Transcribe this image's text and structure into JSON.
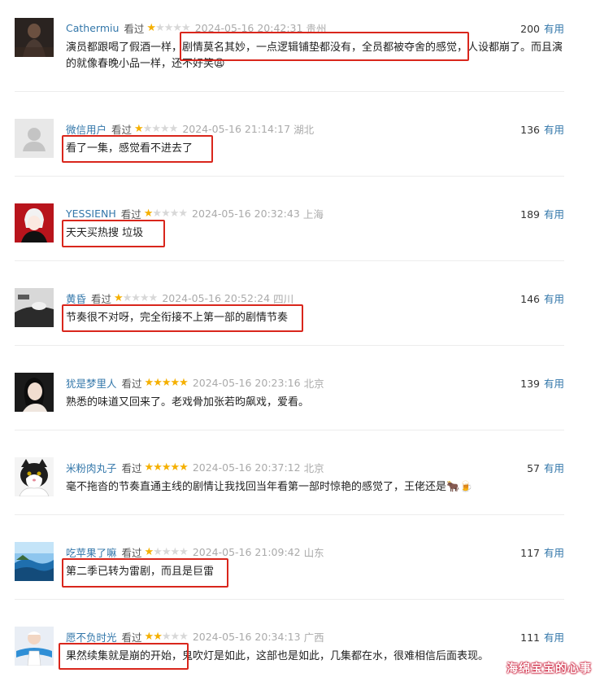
{
  "reviews": [
    {
      "user": "Cathermiu",
      "watched": "看过",
      "rating": 1,
      "time": "2024-05-16 20:42:31",
      "location": "贵州",
      "useful_count": "200",
      "useful_label": "有用",
      "content": "演员都跟喝了假酒一样，剧情莫名其妙，一点逻辑铺垫都没有，全员都被夺舍的感觉，人设都崩了。而且演的就像春晚小品一样，还不好笑😩"
    },
    {
      "user": "微信用户",
      "watched": "看过",
      "rating": 1,
      "time": "2024-05-16 21:14:17",
      "location": "湖北",
      "useful_count": "136",
      "useful_label": "有用",
      "content": "看了一集，感觉看不进去了"
    },
    {
      "user": "YESSIENH",
      "watched": "看过",
      "rating": 1,
      "time": "2024-05-16 20:32:43",
      "location": "上海",
      "useful_count": "189",
      "useful_label": "有用",
      "content": "天天买热搜 垃圾"
    },
    {
      "user": "黄昏",
      "watched": "看过",
      "rating": 1,
      "time": "2024-05-16 20:52:24",
      "location": "四川",
      "useful_count": "146",
      "useful_label": "有用",
      "content": "节奏很不对呀，完全衔接不上第一部的剧情节奏"
    },
    {
      "user": "犹是梦里人",
      "watched": "看过",
      "rating": 5,
      "time": "2024-05-16 20:23:16",
      "location": "北京",
      "useful_count": "139",
      "useful_label": "有用",
      "content": "熟悉的味道又回来了。老戏骨加张若昀飙戏，爱看。"
    },
    {
      "user": "米粉肉丸子",
      "watched": "看过",
      "rating": 5,
      "time": "2024-05-16 20:37:12",
      "location": "北京",
      "useful_count": "57",
      "useful_label": "有用",
      "content": "毫不拖沓的节奏直通主线的剧情让我找回当年看第一部时惊艳的感觉了，王佬还是🐂🍺"
    },
    {
      "user": "吃苹果了嘛",
      "watched": "看过",
      "rating": 1,
      "time": "2024-05-16 21:09:42",
      "location": "山东",
      "useful_count": "117",
      "useful_label": "有用",
      "content": "第二季已转为雷剧，而且是巨雷"
    },
    {
      "user": "愿不负时光",
      "watched": "看过",
      "rating": 2,
      "time": "2024-05-16 20:34:13",
      "location": "广西",
      "useful_count": "111",
      "useful_label": "有用",
      "content": "果然续集就是崩的开始，鬼吹灯是如此，这部也是如此，几集都在水，很难相信后面表现。"
    }
  ],
  "watermark": "海绵宝宝的心事",
  "colors": {
    "username": "#3377aa",
    "star": "#f5b000",
    "highlight_box": "#d9261c",
    "meta": "#aaaaaa"
  }
}
